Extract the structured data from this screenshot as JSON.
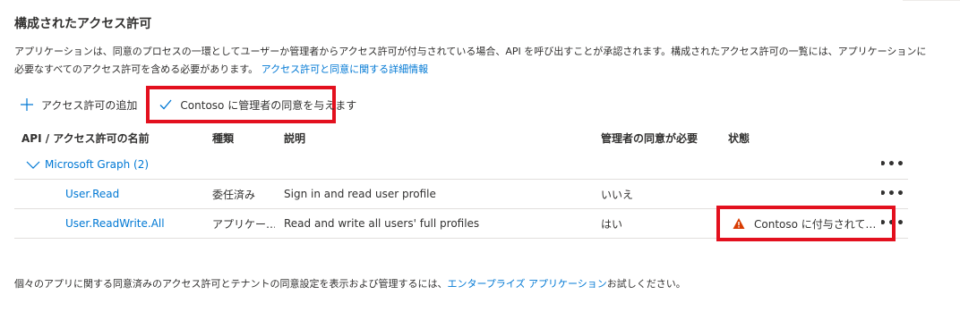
{
  "section": {
    "title": "構成されたアクセス許可",
    "description": "アプリケーションは、同意のプロセスの一環としてユーザーか管理者からアクセス許可が付与されている場合、API を呼び出すことが承認されます。構成されたアクセス許可の一覧には、アプリケーションに必要なすべてのアクセス許可を含める必要があります。",
    "learn_more_link": "アクセス許可と同意に関する詳細情報"
  },
  "toolbar": {
    "add_permission_label": "アクセス許可の追加",
    "grant_consent_label": "Contoso に管理者の同意を与えます"
  },
  "table": {
    "columns": {
      "name": "API / アクセス許可の名前",
      "type": "種類",
      "description": "説明",
      "admin_consent": "管理者の同意が必要",
      "status": "状態"
    },
    "group": {
      "label": "Microsoft Graph (2)"
    },
    "rows": [
      {
        "name": "User.Read",
        "type": "委任済み",
        "description": "Sign in and read user profile",
        "admin_consent": "いいえ",
        "status": ""
      },
      {
        "name": "User.ReadWrite.All",
        "type": "アプリケー…",
        "description": "Read and write all users' full profiles",
        "admin_consent": "はい",
        "status": "Contoso に付与されてい…"
      }
    ],
    "more_label": "•••"
  },
  "footer": {
    "text_before": "個々のアプリに関する同意済みのアクセス許可とテナントの同意設定を表示および管理するには、",
    "link": "エンタープライズ アプリケーション",
    "text_after": "お試しください。"
  },
  "colors": {
    "accent": "#0078d4",
    "highlight_border": "#e3101e",
    "warning": "#d83b01"
  },
  "icons": {
    "add": "plus-icon",
    "grant": "checkmark-icon",
    "group": "chevron-down-icon",
    "status": "warning-icon",
    "more": "more-icon"
  }
}
